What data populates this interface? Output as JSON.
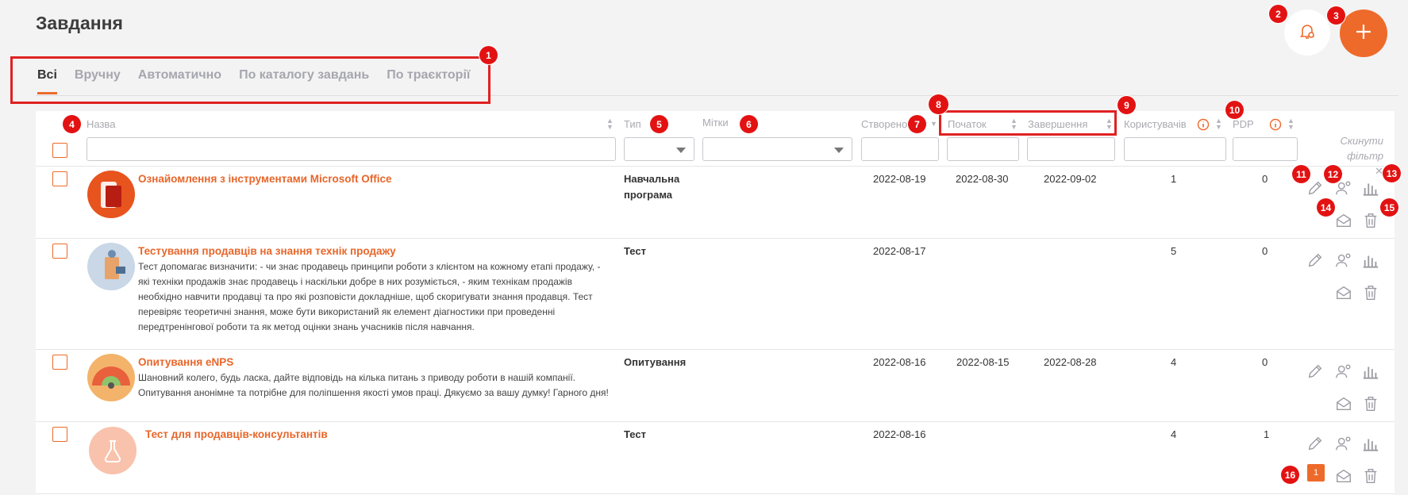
{
  "page": {
    "title": "Завдання"
  },
  "tabs": [
    {
      "label": "Всі",
      "active": true
    },
    {
      "label": "Вручну",
      "active": false
    },
    {
      "label": "Автоматично",
      "active": false
    },
    {
      "label": "По каталогу завдань",
      "active": false
    },
    {
      "label": "По траєкторії",
      "active": false
    }
  ],
  "columns": {
    "name": "Назва",
    "type": "Тип",
    "tags": "Мітки",
    "created": "Створено",
    "start": "Початок",
    "end": "Завершення",
    "users": "Користувачів",
    "pdp": "PDP"
  },
  "reset_filter": "Скинути фільтр",
  "annotations": [
    "1",
    "2",
    "3",
    "4",
    "5",
    "6",
    "7",
    "8",
    "9",
    "10",
    "11",
    "12",
    "13",
    "14",
    "15",
    "16"
  ],
  "rows": [
    {
      "title": "Ознайомлення з інструментами Microsoft Office",
      "description": "",
      "type": "Навчальна програма",
      "created": "2022-08-19",
      "start": "2022-08-30",
      "end": "2022-09-02",
      "users": "1",
      "pdp": "0"
    },
    {
      "title": "Тестування продавців на знання технік продажу",
      "description": "Тест допомагає визначити: - чи знає продавець принципи роботи з клієнтом на кожному етапі продажу, - які техніки продажів знає продавець і наскільки добре в них розуміється, - яким технікам продажів необхідно навчити продавці та про які розповісти докладніше, щоб скоригувати знання продавця. Тест перевіряє теоретичні знання, може бути використаний як елемент діагностики при проведенні передтренінгової роботи та як метод оцінки знань учасників після навчання.",
      "type": "Тест",
      "created": "2022-08-17",
      "start": "",
      "end": "",
      "users": "5",
      "pdp": "0"
    },
    {
      "title": "Опитування eNPS",
      "description": "Шановний колего, будь ласка, дайте відповідь на кілька питань з приводу роботи в нашій компанії. Опитування анонімне та потрібне для поліпшення якості умов праці. Дякуємо за вашу думку! Гарного дня!",
      "type": "Опитування",
      "created": "2022-08-16",
      "start": "2022-08-15",
      "end": "2022-08-28",
      "users": "4",
      "pdp": "0"
    },
    {
      "title": "Тест для продавців-консультантів",
      "description": "",
      "type": "Тест",
      "created": "2022-08-16",
      "start": "",
      "end": "",
      "users": "4",
      "pdp": "1",
      "notification_count": "1"
    }
  ],
  "colors": {
    "accent": "#ee6a2a",
    "annotation": "#e31212"
  },
  "icons": [
    "bell-settings-icon",
    "plus-icon",
    "edit-icon",
    "assign-user-icon",
    "statistics-icon",
    "mail-icon",
    "delete-icon",
    "info-icon",
    "sort-icon",
    "close-icon"
  ]
}
